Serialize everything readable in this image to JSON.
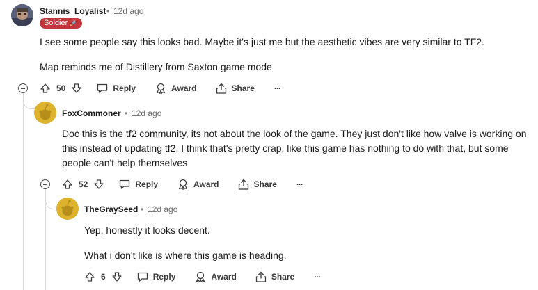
{
  "comments": [
    {
      "username": "Stannis_Loyalist",
      "separator": "•",
      "time": "12d ago",
      "flair": "Soldier",
      "flair_emoji": "🚀",
      "paragraphs": [
        "I see some people say this looks bad. Maybe it's just me but the aesthetic vibes are very similar to TF2.",
        "Map reminds me of Distillery from Saxton game mode"
      ],
      "votes": "50",
      "reply_label": "Reply",
      "award_label": "Award",
      "share_label": "Share",
      "more_label": "···"
    },
    {
      "username": "FoxCommoner",
      "separator": "•",
      "time": "12d ago",
      "paragraphs": [
        "Doc this is the tf2 community, its not about the look of the game. They just don't like how valve is working on this instead of updating tf2. I think that's pretty crap, like this game has nothing to do with that, but some people can't help themselves"
      ],
      "votes": "52",
      "reply_label": "Reply",
      "award_label": "Award",
      "share_label": "Share",
      "more_label": "···"
    },
    {
      "username": "TheGraySeed",
      "separator": "•",
      "time": "12d ago",
      "paragraphs": [
        "Yep, honestly it looks decent.",
        "What i don't like is where this game is heading."
      ],
      "votes": "6",
      "reply_label": "Reply",
      "award_label": "Award",
      "share_label": "Share",
      "more_label": "···"
    }
  ],
  "colors": {
    "flair_bg": "#c4343d",
    "rail": "#d5d7d9",
    "snoo_yellow": "#ddb22c"
  }
}
